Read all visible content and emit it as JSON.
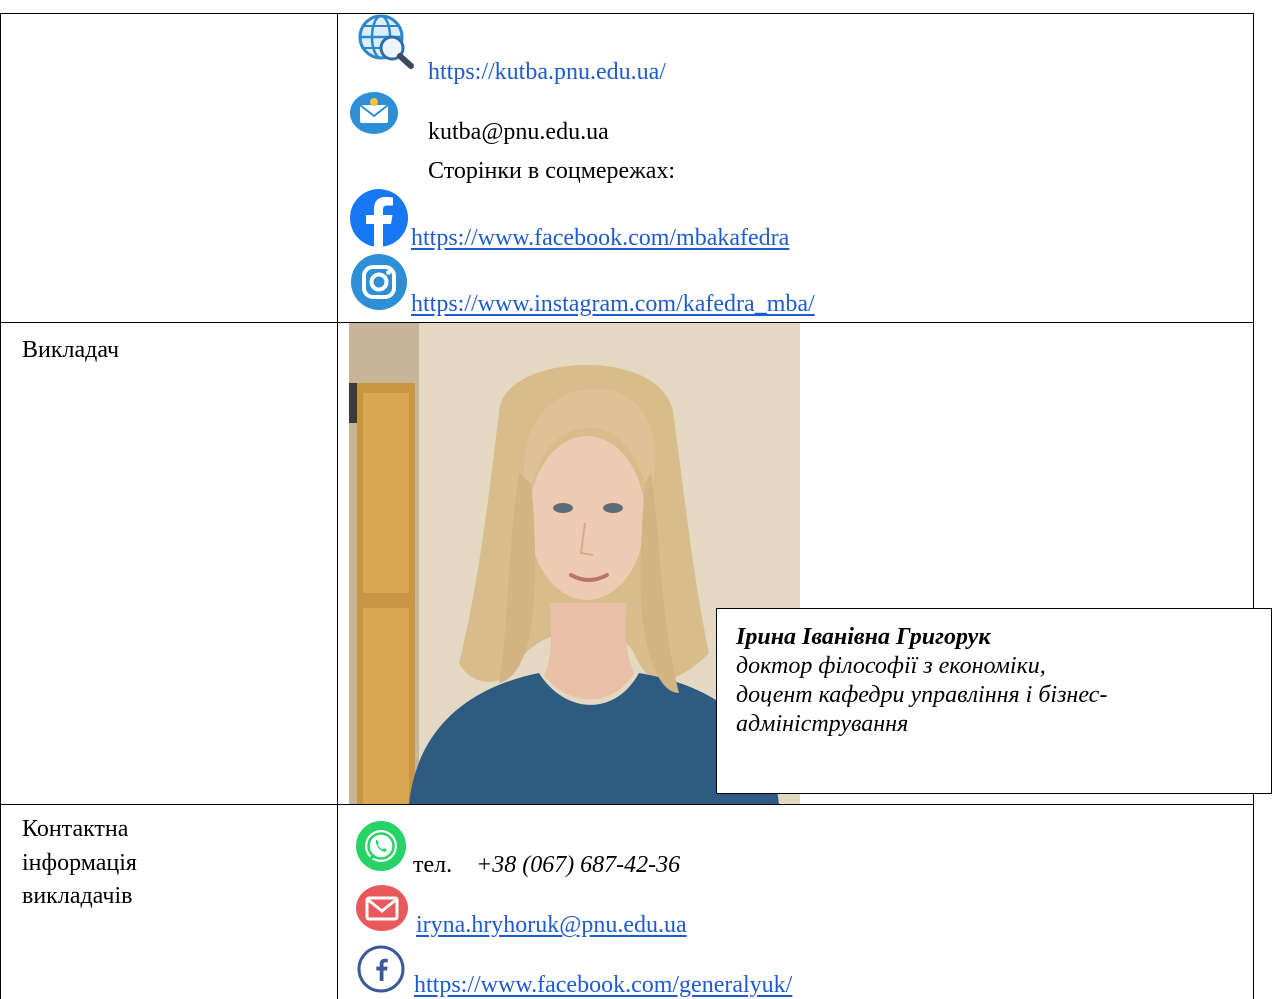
{
  "website": {
    "url": "https://kutba.pnu.edu.ua/",
    "icon": "globe-search-icon"
  },
  "email": {
    "address": "kutba@pnu.edu.ua",
    "icon": "envelope-badge-icon"
  },
  "social": {
    "heading": "Сторінки в соцмережах:",
    "facebook_url": "https://www.facebook.com/mbakafedra",
    "instagram_url": "https://www.instagram.com/kafedra_mba/"
  },
  "teacher": {
    "row_label": "Викладач",
    "name": "Ірина Іванівна Григорук",
    "degree": "доктор філософії з економіки,",
    "position_line1": "доцент кафедри управління і бізнес-",
    "position_line2": "адміністрування"
  },
  "contacts": {
    "row_label_line1": "Контактна",
    "row_label_line2": "інформація",
    "row_label_line3": "викладачів",
    "phone_prefix": "тел.",
    "phone_number": "+38 (067) 687-42-36",
    "email": "iryna.hryhoruk@pnu.edu.ua",
    "facebook_url": "https://www.facebook.com/generalyuk/"
  },
  "colors": {
    "link": "#1f5bd0",
    "facebook": "#1877f2",
    "whatsapp": "#25d366",
    "mail": "#e9595b"
  }
}
